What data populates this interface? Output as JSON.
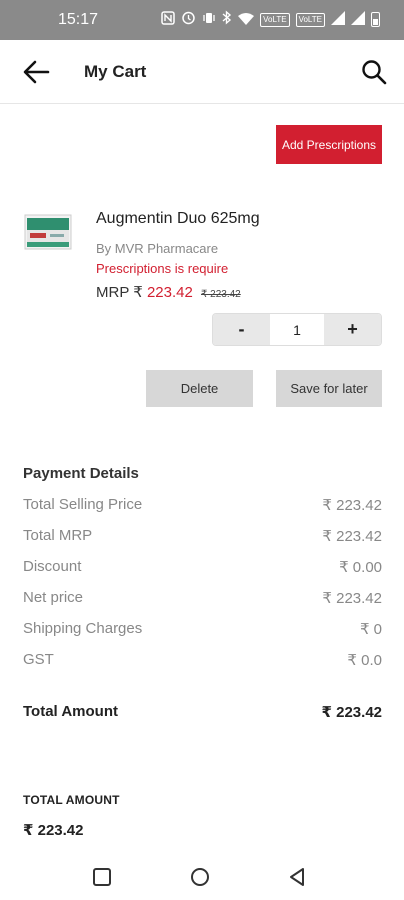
{
  "status_bar": {
    "time": "15:17",
    "icons": [
      "nfc-icon",
      "alarm-icon",
      "vibrate-icon",
      "bluetooth-icon",
      "wifi-icon",
      "volte-icon",
      "volte-icon-2",
      "signal-icon",
      "signal-icon-2",
      "battery-icon"
    ],
    "volte_label_1": "VoLTE",
    "volte_label_2": "VoLTE"
  },
  "app_bar": {
    "title": "My Cart"
  },
  "cart": {
    "add_prescriptions_label": "Add Prescriptions",
    "item": {
      "name": "Augmentin Duo 625mg",
      "seller": "By MVR Pharmacare",
      "rx_note": "Prescriptions is require",
      "mrp_prefix": "MRP ₹",
      "sale_price": "223.42",
      "mrp_strike": "₹ 223.42",
      "quantity": "1",
      "decrement_label": "-",
      "increment_label": "+"
    },
    "delete_label": "Delete",
    "save_for_later_label": "Save for later"
  },
  "payment": {
    "title": "Payment Details",
    "rows": [
      {
        "label": "Total Selling Price",
        "value": "₹ 223.42"
      },
      {
        "label": "Total MRP",
        "value": "₹ 223.42"
      },
      {
        "label": "Discount",
        "value": "₹ 0.00"
      },
      {
        "label": "Net price",
        "value": "₹ 223.42"
      },
      {
        "label": "Shipping Charges",
        "value": "₹ 0"
      },
      {
        "label": "GST",
        "value": "₹ 0.0"
      }
    ],
    "total_label": "Total Amount",
    "total_value": "₹ 223.42"
  },
  "footer": {
    "label": "TOTAL AMOUNT",
    "amount": "₹ 223.42"
  },
  "colors": {
    "accent": "#d21f30",
    "status_bar": "#8a8a8a",
    "button_grey": "#d7d7d7"
  }
}
